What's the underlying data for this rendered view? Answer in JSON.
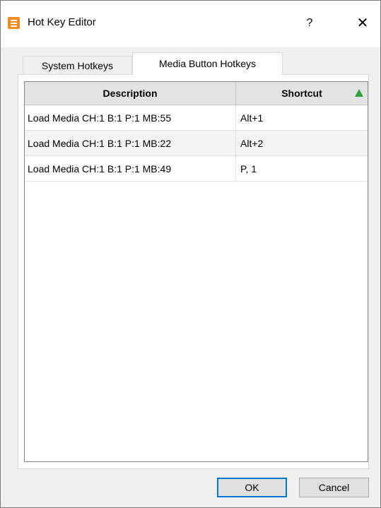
{
  "window": {
    "title": "Hot Key Editor",
    "help_label": "?",
    "close_label": "✕",
    "icon": "app-icon"
  },
  "tabs": [
    {
      "label": "System Hotkeys",
      "active": false
    },
    {
      "label": "Media Button Hotkeys",
      "active": true
    }
  ],
  "table": {
    "columns": [
      "Description",
      "Shortcut"
    ],
    "sort": {
      "column": "Shortcut",
      "direction": "ascending",
      "icon": "sort-ascending-icon",
      "color": "#2ea43a"
    },
    "rows": [
      {
        "description": "Load Media CH:1 B:1 P:1 MB:55",
        "shortcut": "Alt+1"
      },
      {
        "description": "Load Media CH:1 B:1 P:1 MB:22",
        "shortcut": "Alt+2"
      },
      {
        "description": "Load Media CH:1 B:1 P:1 MB:49",
        "shortcut": "P, 1"
      }
    ]
  },
  "buttons": {
    "ok_label": "OK",
    "cancel_label": "Cancel"
  },
  "colors": {
    "accent": "#0078d7",
    "app_icon": "#f28b1e"
  }
}
